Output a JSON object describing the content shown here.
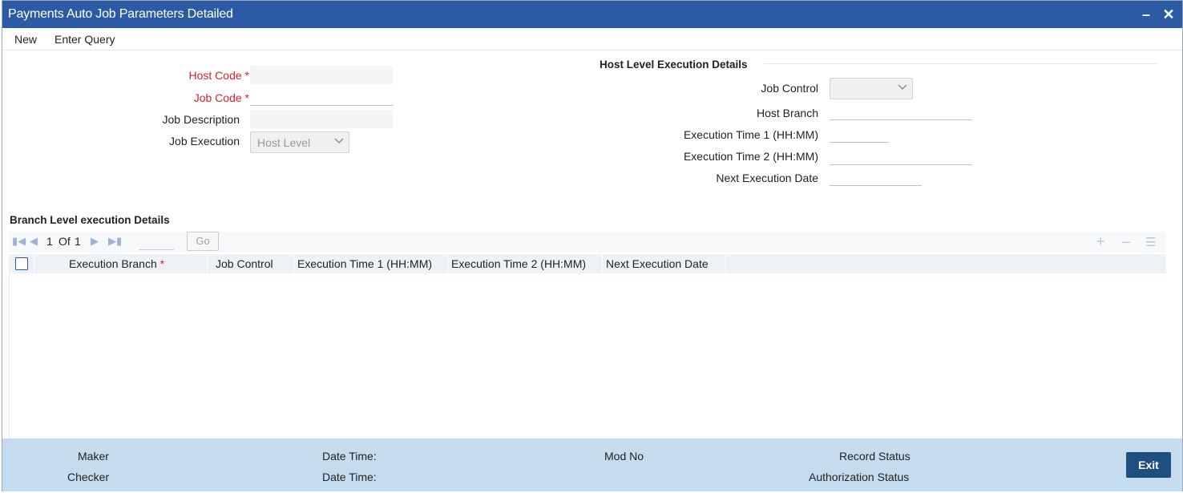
{
  "window": {
    "title": "Payments Auto Job Parameters Detailed",
    "minimize_icon": "minimize-icon",
    "close_icon": "close-icon"
  },
  "menu": {
    "new": "New",
    "enter_query": "Enter Query"
  },
  "form": {
    "host_code": {
      "label": "Host Code",
      "value": ""
    },
    "job_code": {
      "label": "Job Code",
      "value": ""
    },
    "job_description": {
      "label": "Job Description",
      "value": ""
    },
    "job_execution": {
      "label": "Job Execution",
      "value": "Host Level"
    }
  },
  "host_level": {
    "title": "Host Level Execution Details",
    "job_control": {
      "label": "Job Control",
      "value": ""
    },
    "host_branch": {
      "label": "Host Branch",
      "value": ""
    },
    "exec_time_1": {
      "label": "Execution Time 1 (HH:MM)",
      "value": ""
    },
    "exec_time_2": {
      "label": "Execution Time 2 (HH:MM)",
      "value": ""
    },
    "next_exec_date": {
      "label": "Next Execution Date",
      "value": ""
    }
  },
  "branch_level": {
    "title": "Branch Level execution Details",
    "pager": {
      "current": "1",
      "of_label": "Of",
      "total": "1",
      "go": "Go"
    },
    "columns": [
      "Execution Branch",
      "Job Control",
      "Execution Time 1 (HH:MM)",
      "Execution Time 2 (HH:MM)",
      "Next Execution Date"
    ],
    "rows": []
  },
  "footer": {
    "maker": "Maker",
    "checker": "Checker",
    "date_time_1": "Date Time:",
    "date_time_2": "Date Time:",
    "mod_no": "Mod No",
    "record_status": "Record Status",
    "authorization_status": "Authorization Status",
    "exit": "Exit"
  },
  "colors": {
    "titlebar": "#2c5ba6",
    "footer": "#c5dcef",
    "exit_button": "#1f4f80",
    "required": "#e0202a"
  }
}
